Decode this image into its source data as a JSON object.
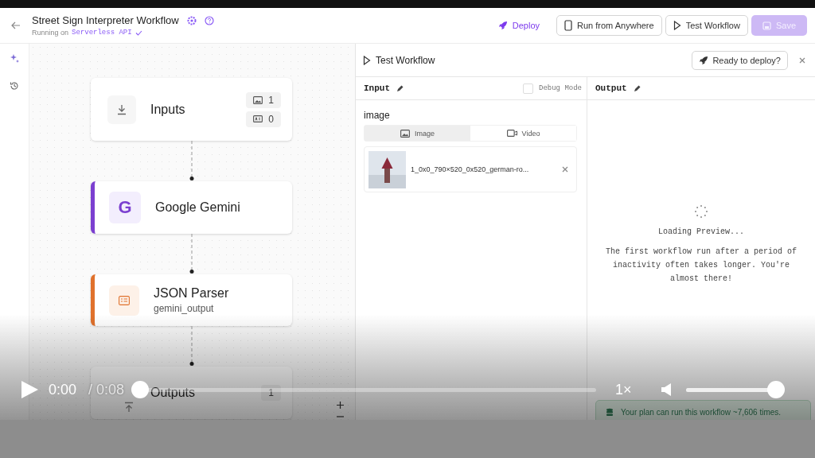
{
  "header": {
    "title": "Street Sign Interpreter Workflow",
    "subtitle_prefix": "Running on",
    "subtitle_target": "Serverless API"
  },
  "actions": [
    {
      "kind": "deploy",
      "label": "Deploy"
    },
    {
      "kind": "device",
      "label": "Run from Anywhere"
    },
    {
      "kind": "test",
      "label": "Test Workflow"
    },
    {
      "kind": "save",
      "label": "Save",
      "disabled": true
    }
  ],
  "canvas": {
    "nodes": [
      {
        "kind": "inputs",
        "title": "Inputs",
        "counts": [
          "1",
          "0"
        ]
      },
      {
        "kind": "model",
        "title": "Google Gemini",
        "badge": "G",
        "color": "#7b3fd0"
      },
      {
        "kind": "parser",
        "title": "JSON Parser",
        "subtitle": "gemini_output",
        "color": "#e0712c"
      },
      {
        "kind": "outputs",
        "title": "Outputs",
        "counts": [
          "1"
        ]
      }
    ]
  },
  "test_panel": {
    "title": "Test Workflow",
    "deploy_button": "Ready to deploy?",
    "input": {
      "heading": "Input",
      "debug": {
        "label": "Debug Mode",
        "checked": false
      },
      "field_label": "image",
      "tabs": [
        {
          "kind": "image",
          "label": "Image",
          "selected": true
        },
        {
          "kind": "video",
          "label": "Video",
          "selected": false
        }
      ],
      "files": [
        {
          "name": "1_0x0_790×520_0x520_german-ro..."
        }
      ]
    },
    "output": {
      "heading": "Output",
      "status": "Loading Preview...",
      "message": "The first workflow run after a period of inactivity often takes longer. You're almost there!"
    },
    "plan_notice": "Your plan can run this workflow ~7,606 times."
  },
  "player": {
    "current": "0:00",
    "duration": "/ 0:08",
    "progress": {
      "level": 0
    },
    "speed": "1×",
    "volume": {
      "level": 1
    }
  }
}
